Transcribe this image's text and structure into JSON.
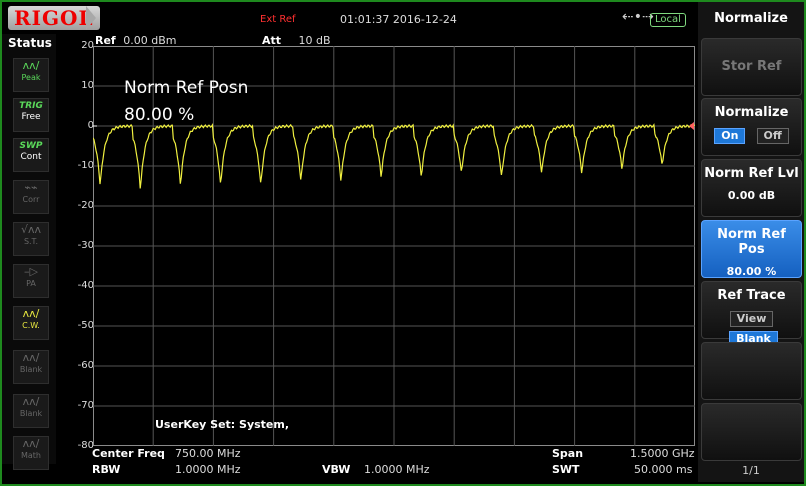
{
  "header": {
    "brand": "RIGOL",
    "ext_ref": "Ext Ref",
    "datetime": "01:01:37 2016-12-24",
    "usb_icon": "usb-icon",
    "local": "Local"
  },
  "status": {
    "title": "Status",
    "items": [
      {
        "top": "",
        "label": "Peak",
        "icon": "peak-icon"
      },
      {
        "top": "TRIG",
        "label": "Free",
        "icon": ""
      },
      {
        "top": "SWP",
        "label": "Cont",
        "icon": ""
      },
      {
        "top": "",
        "label": "Corr",
        "icon": "corr-icon"
      },
      {
        "top": "",
        "label": "S.T.",
        "icon": "st-icon"
      },
      {
        "top": "",
        "label": "PA",
        "icon": "pa-icon"
      },
      {
        "top": "",
        "label": "C.W.",
        "icon": "cw-icon"
      },
      {
        "top": "",
        "label": "Blank",
        "icon": "blank-icon"
      },
      {
        "top": "",
        "label": "Blank",
        "icon": "blank-icon"
      },
      {
        "top": "",
        "label": "Math",
        "icon": "math-icon"
      }
    ]
  },
  "plot": {
    "ref_label": "Ref",
    "ref_value": "0.00 dBm",
    "att_label": "Att",
    "att_value": "10 dB",
    "y_ticks": [
      "20",
      "10",
      "0",
      "-10",
      "-20",
      "-30",
      "-40",
      "-50",
      "-60",
      "-70",
      "-80"
    ],
    "overlay_title": "Norm Ref Posn",
    "overlay_value": "80.00 %",
    "userkey": "UserKey Set:   System,"
  },
  "chart_data": {
    "type": "line",
    "ylim": [
      -80,
      20
    ],
    "grid": true,
    "series": [
      {
        "color": "#f0f040",
        "periods": 15,
        "peak_db": 0,
        "notch_db": [
          -15,
          -16,
          -15,
          -15,
          -15,
          -14,
          -14,
          -13,
          -13,
          -12,
          -13,
          -12,
          -12,
          -11,
          -10
        ]
      }
    ]
  },
  "bottom": {
    "center_freq_label": "Center Freq",
    "center_freq_value": "750.00 MHz",
    "span_label": "Span",
    "span_value": "1.5000 GHz",
    "rbw_label": "RBW",
    "rbw_value": "1.0000 MHz",
    "vbw_label": "VBW",
    "vbw_value": "1.0000 MHz",
    "swt_label": "SWT",
    "swt_value": "50.000 ms"
  },
  "menu": {
    "title": "Normalize",
    "stor_ref": "Stor Ref",
    "normalize": "Normalize",
    "normalize_on": "On",
    "normalize_off": "Off",
    "norm_ref_lvl": "Norm Ref Lvl",
    "norm_ref_lvl_value": "0.00 dB",
    "norm_ref_pos": "Norm Ref Pos",
    "norm_ref_pos_value": "80.00 %",
    "ref_trace": "Ref Trace",
    "ref_trace_view": "View",
    "ref_trace_blank": "Blank",
    "page": "1/1"
  }
}
